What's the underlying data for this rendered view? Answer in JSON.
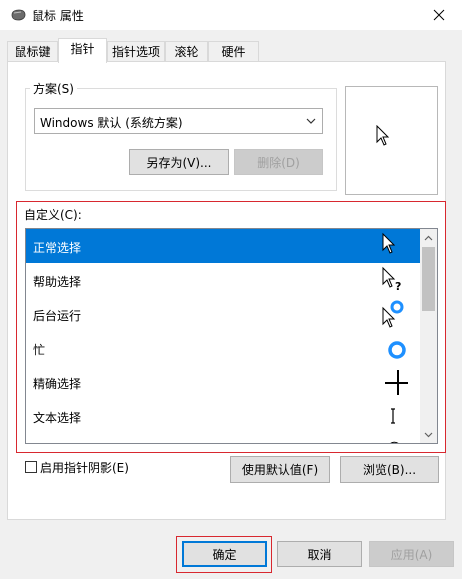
{
  "window": {
    "title": "鼠标 属性"
  },
  "tabs": [
    {
      "label": "鼠标键"
    },
    {
      "label": "指针"
    },
    {
      "label": "指针选项"
    },
    {
      "label": "滚轮"
    },
    {
      "label": "硬件"
    }
  ],
  "scheme": {
    "legend": "方案(S)",
    "selected": "Windows 默认 (系统方案)",
    "save_as_label": "另存为(V)...",
    "delete_label": "删除(D)"
  },
  "custom": {
    "label": "自定义(C):",
    "items": [
      {
        "label": "正常选择",
        "cursor": "arrow-icon"
      },
      {
        "label": "帮助选择",
        "cursor": "help-select-icon"
      },
      {
        "label": "后台运行",
        "cursor": "working-in-background-icon"
      },
      {
        "label": "忙",
        "cursor": "busy-icon"
      },
      {
        "label": "精确选择",
        "cursor": "precision-select-icon"
      },
      {
        "label": "文本选择",
        "cursor": "text-select-icon"
      },
      {
        "label": "",
        "cursor": "handwriting-icon"
      }
    ]
  },
  "options": {
    "shadow_label": "启用指针阴影(E)",
    "use_default_label": "使用默认值(F)",
    "browse_label": "浏览(B)..."
  },
  "footer": {
    "ok_label": "确定",
    "cancel_label": "取消",
    "apply_label": "应用(A)"
  },
  "colors": {
    "selection": "#0078d7",
    "highlight_border": "#d8282f"
  }
}
